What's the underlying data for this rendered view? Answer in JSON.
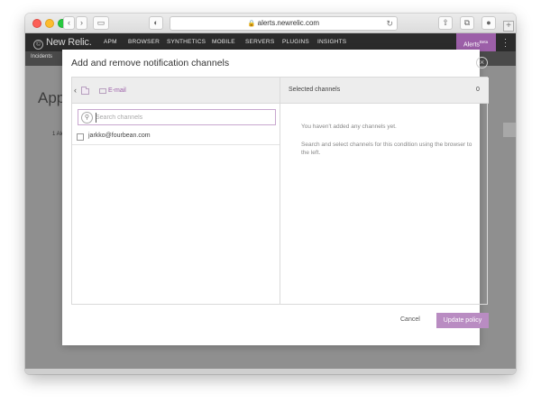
{
  "browser": {
    "url": "alerts.newrelic.com",
    "back_icon": "chevron-left-icon",
    "forward_icon": "chevron-right-icon",
    "new_tab_label": "+"
  },
  "app": {
    "logo_text": "New Relic.",
    "nav": [
      "APM",
      "BROWSER",
      "SYNTHETICS",
      "MOBILE",
      "SERVERS",
      "PLUGINS",
      "INSIGHTS"
    ],
    "alerts_label": "Alerts",
    "alerts_badge": "Beta",
    "subnav_label": "Incidents",
    "page_title": "App",
    "page_small_text": "1 Ale",
    "page_right_text_1": "y",
    "page_right_text_2": "m"
  },
  "modal": {
    "title": "Add and remove notification channels",
    "breadcrumb_label": "E-mail",
    "search_placeholder": "Search channels",
    "channels": [
      {
        "label": "jarkko@fourbean.com",
        "checked": false
      }
    ],
    "selected_title": "Selected channels",
    "selected_count": "0",
    "empty_message": "You haven't added any channels yet.",
    "help_text": "Search and select channels for this condition using the browser to the left.",
    "cancel_label": "Cancel",
    "update_label": "Update policy"
  },
  "colors": {
    "accent": "#9c5fa8",
    "button": "#b98cc2",
    "nav_bg": "#2b2b2b"
  }
}
